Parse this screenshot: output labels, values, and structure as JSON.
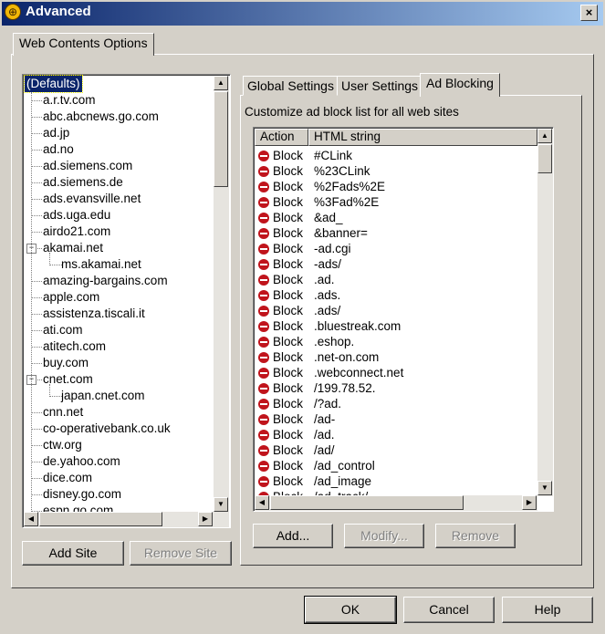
{
  "window": {
    "title": "Advanced",
    "close_label": "×"
  },
  "outer_tab": "Web Contents Options",
  "sites": {
    "items": [
      {
        "label": "(Defaults)",
        "level": 0,
        "selected": true
      },
      {
        "label": "a.r.tv.com",
        "level": 0
      },
      {
        "label": "abc.abcnews.go.com",
        "level": 0
      },
      {
        "label": "ad.jp",
        "level": 0
      },
      {
        "label": "ad.no",
        "level": 0
      },
      {
        "label": "ad.siemens.com",
        "level": 0
      },
      {
        "label": "ad.siemens.de",
        "level": 0
      },
      {
        "label": "ads.evansville.net",
        "level": 0
      },
      {
        "label": "ads.uga.edu",
        "level": 0
      },
      {
        "label": "airdo21.com",
        "level": 0
      },
      {
        "label": "akamai.net",
        "level": 0,
        "expanded": true
      },
      {
        "label": "ms.akamai.net",
        "level": 1
      },
      {
        "label": "amazing-bargains.com",
        "level": 0
      },
      {
        "label": "apple.com",
        "level": 0
      },
      {
        "label": "assistenza.tiscali.it",
        "level": 0
      },
      {
        "label": "ati.com",
        "level": 0
      },
      {
        "label": "atitech.com",
        "level": 0
      },
      {
        "label": "buy.com",
        "level": 0
      },
      {
        "label": "cnet.com",
        "level": 0,
        "expanded": true
      },
      {
        "label": "japan.cnet.com",
        "level": 1
      },
      {
        "label": "cnn.net",
        "level": 0
      },
      {
        "label": "co-operativebank.co.uk",
        "level": 0
      },
      {
        "label": "ctw.org",
        "level": 0
      },
      {
        "label": "de.yahoo.com",
        "level": 0
      },
      {
        "label": "dice.com",
        "level": 0
      },
      {
        "label": "disney.go.com",
        "level": 0
      },
      {
        "label": "espn.go.com",
        "level": 0
      }
    ],
    "expander_symbol": "−",
    "add_button": "Add Site",
    "remove_button": "Remove Site"
  },
  "tabs": [
    {
      "label": "Global Settings",
      "active": false
    },
    {
      "label": "User Settings",
      "active": false
    },
    {
      "label": "Ad Blocking",
      "active": true
    }
  ],
  "ad_blocking": {
    "description": "Customize ad block list for all web sites",
    "columns": [
      "Action",
      "HTML string"
    ],
    "rows": [
      {
        "action": "Block",
        "string": "#CLink"
      },
      {
        "action": "Block",
        "string": "%23CLink"
      },
      {
        "action": "Block",
        "string": "%2Fads%2E"
      },
      {
        "action": "Block",
        "string": "%3Fad%2E"
      },
      {
        "action": "Block",
        "string": "&ad_"
      },
      {
        "action": "Block",
        "string": "&banner="
      },
      {
        "action": "Block",
        "string": "-ad.cgi"
      },
      {
        "action": "Block",
        "string": "-ads/"
      },
      {
        "action": "Block",
        "string": ".ad."
      },
      {
        "action": "Block",
        "string": ".ads."
      },
      {
        "action": "Block",
        "string": ".ads/"
      },
      {
        "action": "Block",
        "string": ".bluestreak.com"
      },
      {
        "action": "Block",
        "string": ".eshop."
      },
      {
        "action": "Block",
        "string": ".net-on.com"
      },
      {
        "action": "Block",
        "string": ".webconnect.net"
      },
      {
        "action": "Block",
        "string": "/199.78.52."
      },
      {
        "action": "Block",
        "string": "/?ad."
      },
      {
        "action": "Block",
        "string": "/ad-"
      },
      {
        "action": "Block",
        "string": "/ad."
      },
      {
        "action": "Block",
        "string": "/ad/"
      },
      {
        "action": "Block",
        "string": "/ad_control"
      },
      {
        "action": "Block",
        "string": "/ad_image"
      },
      {
        "action": "Block",
        "string": "/ad_track/"
      }
    ],
    "add_button": "Add...",
    "modify_button": "Modify...",
    "remove_button": "Remove"
  },
  "footer": {
    "ok": "OK",
    "cancel": "Cancel",
    "help": "Help"
  },
  "colors": {
    "title_start": "#0a246a",
    "title_end": "#a6caf0",
    "selection": "#0a246a",
    "block_icon": "#c0141c"
  },
  "icons": {
    "app": "globe-icon",
    "block": "no-entry-icon"
  }
}
